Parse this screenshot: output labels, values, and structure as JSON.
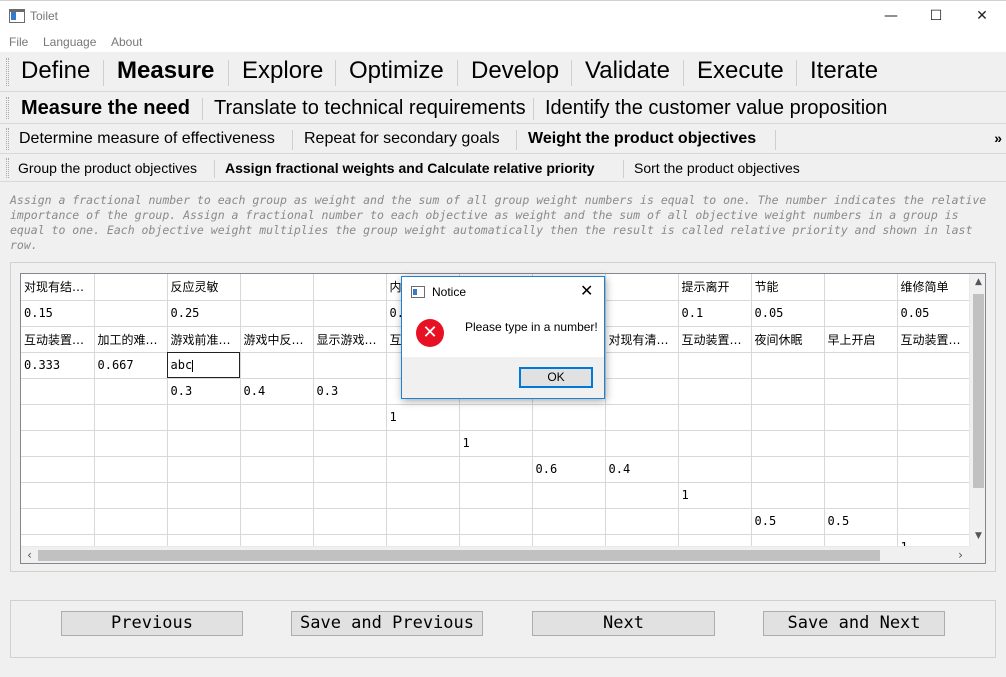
{
  "window": {
    "title": "Toilet",
    "minimize": "—",
    "maximize": "☐",
    "close": "✕"
  },
  "menu": [
    "File",
    "Language",
    "About"
  ],
  "tabs_level1": [
    "Define",
    "Measure",
    "Explore",
    "Optimize",
    "Develop",
    "Validate",
    "Execute",
    "Iterate"
  ],
  "tabs_level2": [
    "Measure the need",
    "Translate to technical requirements",
    "Identify the customer value proposition"
  ],
  "tabs_level3": [
    "Determine measure of effectiveness",
    "Repeat for secondary goals",
    "Weight the product objectives"
  ],
  "tabs_level3_overflow": "»",
  "tabs_level4": [
    "Group the product objectives",
    "Assign fractional weights and Calculate relative priority",
    "Sort the product objectives"
  ],
  "description": "Assign a fractional number to each group as weight and the sum of all group weight numbers is equal to one. The number indicates the relative importance of the group. Assign a fractional number to each objective as weight and the sum of all objective weight numbers in a group is equal to one. Each objective weight multiplies the group weight automatically then the result is called relative priority and shown in last row.",
  "grid": {
    "rows": [
      [
        "对现有结…",
        "",
        "反应灵敏",
        "",
        "",
        "内…",
        "",
        "",
        "",
        "提示离开",
        "节能",
        "",
        "维修简单"
      ],
      [
        "0.15",
        "",
        "0.25",
        "",
        "",
        "0.…",
        "",
        "",
        "",
        "0.1",
        "0.05",
        "",
        "0.05"
      ],
      [
        "互动装置…",
        "加工的难…",
        "游戏前准…",
        "游戏中反…",
        "显示游戏…",
        "互…",
        "",
        "",
        "对现有清…",
        "互动装置…",
        "夜间休眠",
        "早上开启",
        "互动装置…"
      ],
      [
        "0.333",
        "0.667",
        "abc",
        "",
        "",
        "",
        "",
        "",
        "",
        "",
        "",
        "",
        ""
      ],
      [
        "",
        "",
        "0.3",
        "0.4",
        "0.3",
        "",
        "",
        "",
        "",
        "",
        "",
        "",
        ""
      ],
      [
        "",
        "",
        "",
        "",
        "",
        "1",
        "",
        "",
        "",
        "",
        "",
        "",
        ""
      ],
      [
        "",
        "",
        "",
        "",
        "",
        "",
        "1",
        "",
        "",
        "",
        "",
        "",
        ""
      ],
      [
        "",
        "",
        "",
        "",
        "",
        "",
        "",
        "0.6",
        "0.4",
        "",
        "",
        "",
        ""
      ],
      [
        "",
        "",
        "",
        "",
        "",
        "",
        "",
        "",
        "",
        "1",
        "",
        "",
        ""
      ],
      [
        "",
        "",
        "",
        "",
        "",
        "",
        "",
        "",
        "",
        "",
        "0.5",
        "0.5",
        ""
      ],
      [
        "",
        "",
        "",
        "",
        "",
        "",
        "",
        "",
        "",
        "",
        "",
        "",
        "1"
      ]
    ],
    "editing_cell": {
      "row": 3,
      "col": 2
    }
  },
  "nav": {
    "previous": "Previous",
    "save_previous": "Save and Previous",
    "next": "Next",
    "save_next": "Save and Next"
  },
  "dialog": {
    "title": "Notice",
    "message": "Please type in a number!",
    "ok": "OK",
    "close": "✕",
    "error_glyph": "✕"
  },
  "scroll": {
    "up": "▲",
    "down": "▼",
    "left": "‹",
    "right": "›"
  },
  "colors": {
    "accent": "#0078d7",
    "error": "#e81123"
  }
}
